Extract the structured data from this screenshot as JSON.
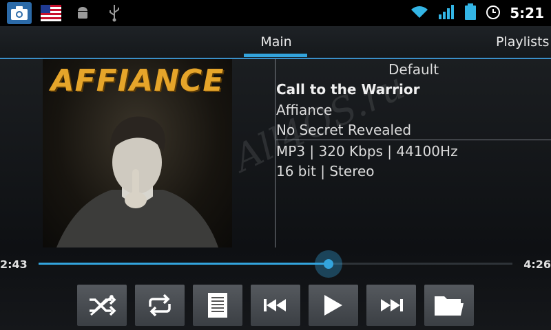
{
  "statusbar": {
    "icons": [
      "camera-icon",
      "us-flag-icon",
      "android-icon",
      "usb-icon",
      "wifi-icon",
      "signal-icon",
      "battery-icon",
      "alarm-icon"
    ],
    "time": "5:21"
  },
  "tabs": [
    {
      "label": "Main",
      "selected": true
    },
    {
      "label": "Playlists",
      "selected": false
    }
  ],
  "album_art": {
    "text": "AFFIANCE"
  },
  "track_info": {
    "playlist": "Default",
    "title": "Call to the Warrior",
    "artist": "Affiance",
    "album": "No Secret Revealed",
    "format": "MP3 | 320 Kbps | 44100Hz",
    "bits": "16 bit | Stereo"
  },
  "watermark": "All4OS.ru",
  "progress": {
    "elapsed": "2:43",
    "total": "4:26",
    "fraction": 0.612
  },
  "controls": [
    "shuffle-icon",
    "repeat-icon",
    "playlist-icon",
    "previous-icon",
    "play-icon",
    "next-icon",
    "folder-icon"
  ],
  "colors": {
    "accent": "#33a4dd",
    "art_title": "#e6a52a"
  }
}
